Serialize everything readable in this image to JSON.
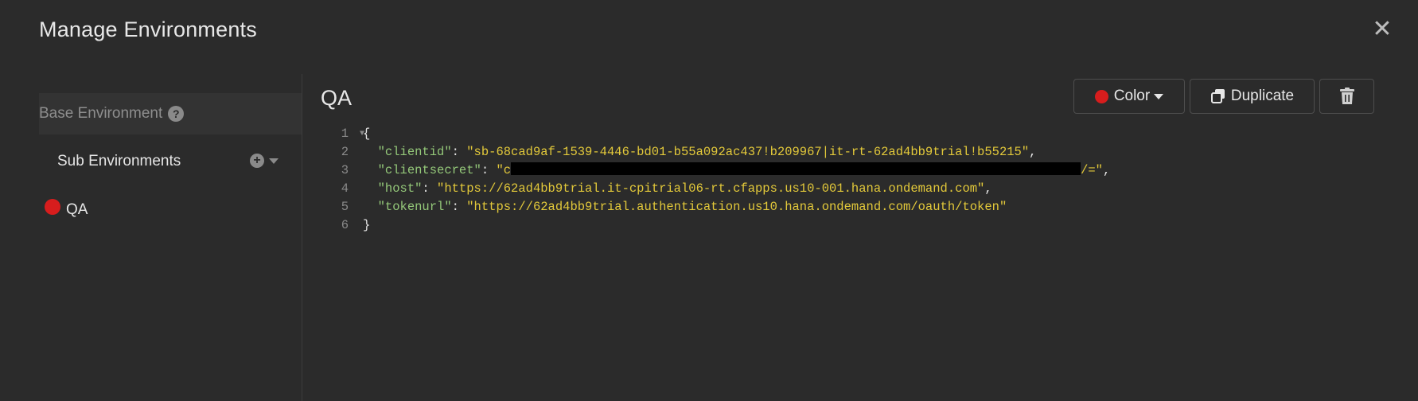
{
  "modal": {
    "title": "Manage Environments",
    "close_symbol": "✕"
  },
  "sidebar": {
    "base_environment_label": "Base Environment",
    "help_symbol": "?",
    "sub_environments_label": "Sub Environments",
    "add_symbol": "+",
    "environments": [
      {
        "name": "QA",
        "color": "#d71d1d"
      }
    ]
  },
  "main": {
    "title": "QA",
    "toolbar": {
      "color_label": "Color",
      "duplicate_label": "Duplicate",
      "delete_icon": "trash-icon"
    },
    "editor": {
      "line_numbers": [
        "1",
        "2",
        "3",
        "4",
        "5",
        "6"
      ],
      "open_brace": "{",
      "close_brace": "}",
      "entries": [
        {
          "key": "\"clientid\"",
          "value": "\"sb-68cad9af-1539-4446-bd01-b55a092ac437!b209967|it-rt-62ad4bb9trial!b55215\"",
          "trail": ","
        },
        {
          "key": "\"clientsecret\"",
          "value_prefix": "\"c",
          "value_suffix": "/=\"",
          "trail": ","
        },
        {
          "key": "\"host\"",
          "value": "\"https://62ad4bb9trial.it-cpitrial06-rt.cfapps.us10-001.hana.ondemand.com\"",
          "trail": ","
        },
        {
          "key": "\"tokenurl\"",
          "value": "\"https://62ad4bb9trial.authentication.us10.hana.ondemand.com/oauth/token\"",
          "trail": ""
        }
      ]
    }
  },
  "colors": {
    "background": "#2b2b2b",
    "accent_red": "#d71d1d",
    "json_key": "#94c879",
    "json_string": "#e3c93a"
  }
}
